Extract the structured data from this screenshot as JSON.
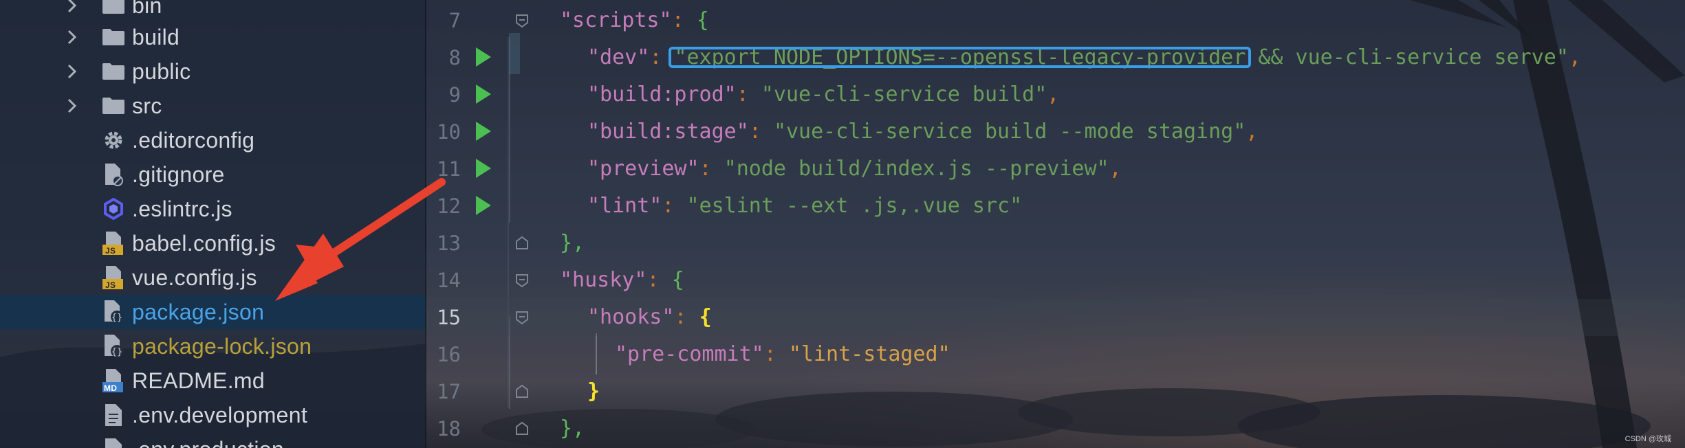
{
  "project_tree": {
    "items": [
      {
        "name": "bin",
        "type": "folder",
        "icon": "folder-icon",
        "expandable": true
      },
      {
        "name": "build",
        "type": "folder",
        "icon": "folder-icon",
        "expandable": true
      },
      {
        "name": "public",
        "type": "folder",
        "icon": "folder-icon",
        "expandable": true
      },
      {
        "name": "src",
        "type": "folder",
        "icon": "folder-icon",
        "expandable": true
      },
      {
        "name": ".editorconfig",
        "type": "file",
        "icon": "gear-icon"
      },
      {
        "name": ".gitignore",
        "type": "file",
        "icon": "gitignore-icon"
      },
      {
        "name": ".eslintrc.js",
        "type": "file",
        "icon": "eslint-icon"
      },
      {
        "name": "babel.config.js",
        "type": "file",
        "icon": "js-file-icon",
        "badge": "JS"
      },
      {
        "name": "vue.config.js",
        "type": "file",
        "icon": "js-file-icon",
        "badge": "JS"
      },
      {
        "name": "package.json",
        "type": "file",
        "icon": "json-file-icon",
        "selected": true
      },
      {
        "name": "package-lock.json",
        "type": "file",
        "icon": "json-file-icon"
      },
      {
        "name": "README.md",
        "type": "file",
        "icon": "markdown-icon",
        "badge": "MD"
      },
      {
        "name": ".env.development",
        "type": "file",
        "icon": "text-file-icon"
      },
      {
        "name": ".env.production",
        "type": "file",
        "icon": "text-file-icon"
      }
    ]
  },
  "editor": {
    "lines": [
      {
        "n": "7",
        "key": "\"scripts\"",
        "value": "",
        "open": "{",
        "close": ""
      },
      {
        "n": "8",
        "key": "\"dev\"",
        "value": "\"export NODE_OPTIONS=--openssl-legacy-provider && vue-cli-service serve\"",
        "comma": ","
      },
      {
        "n": "9",
        "key": "\"build:prod\"",
        "value": "\"vue-cli-service build\"",
        "comma": ","
      },
      {
        "n": "10",
        "key": "\"build:stage\"",
        "value": "\"vue-cli-service build --mode staging\"",
        "comma": ","
      },
      {
        "n": "11",
        "key": "\"preview\"",
        "value": "\"node build/index.js --preview\"",
        "comma": ","
      },
      {
        "n": "12",
        "key": "\"lint\"",
        "value": "\"eslint --ext .js,.vue src\"",
        "comma": ""
      },
      {
        "n": "13",
        "text": "},"
      },
      {
        "n": "14",
        "key": "\"husky\"",
        "open": "{"
      },
      {
        "n": "15",
        "key": "\"hooks\"",
        "open": "{"
      },
      {
        "n": "16",
        "key": "\"pre-commit\"",
        "value": "\"lint-staged\""
      },
      {
        "n": "17",
        "text": "}"
      },
      {
        "n": "18",
        "text": "},"
      }
    ],
    "dev_value_highlighted": "\"export NODE_OPTIONS=--openssl-legacy-provider",
    "dev_value_rest": " && vue-cli-service serve\"",
    "current_line": "15"
  },
  "colors": {
    "highlight_box": "#3a9de8",
    "arrow": "#e8412d",
    "run_icon": "#4cbf52"
  },
  "watermark": "CSDN @玫城"
}
